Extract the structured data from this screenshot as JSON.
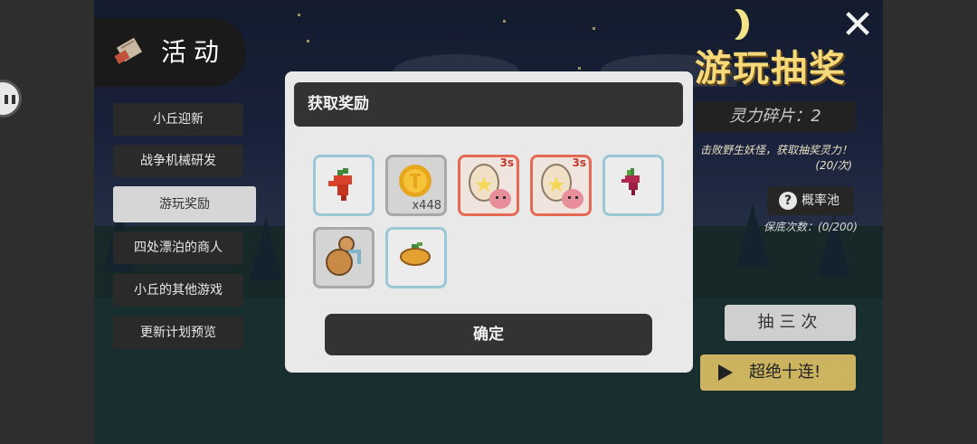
{
  "activity": {
    "title": "活动",
    "icon": "scroll-icon"
  },
  "menu": {
    "items": [
      {
        "label": "小丘迎新"
      },
      {
        "label": "战争机械研发"
      },
      {
        "label": "游玩奖励",
        "active": true
      },
      {
        "label": "四处漂泊的商人"
      },
      {
        "label": "小丘的其他游戏"
      },
      {
        "label": "更新计划预览"
      }
    ]
  },
  "lottery": {
    "title": "游玩抽奖",
    "fragments": "灵力碎片：2",
    "hint_line1": "击败野生妖怪，获取抽奖灵力！",
    "hint_line2": "(20/次)",
    "prob_label": "概率池",
    "guarantee": "保底次数：(0/200)",
    "draw3_label": "抽三次",
    "draw10_label": "超绝十连!"
  },
  "modal": {
    "title": "获取奖励",
    "confirm_label": "确定",
    "items": [
      {
        "icon": "red-pepper-icon",
        "border": "blue"
      },
      {
        "icon": "gold-coin-icon",
        "border": "gray",
        "qty": "x448"
      },
      {
        "icon": "pet-egg-icon",
        "border": "red",
        "timer": "3s"
      },
      {
        "icon": "pet-egg-icon",
        "border": "red",
        "timer": "3s"
      },
      {
        "icon": "beet-icon",
        "border": "blue"
      },
      {
        "icon": "gourd-icon",
        "border": "gray"
      },
      {
        "icon": "orange-fruit-icon",
        "border": "blue"
      }
    ]
  },
  "colors": {
    "title_gold": "#f6d978",
    "draw10_bg": "#ccb360",
    "slot_blue": "#9cc7d6",
    "slot_red": "#e56a55",
    "slot_gray": "#a8a8a8"
  }
}
